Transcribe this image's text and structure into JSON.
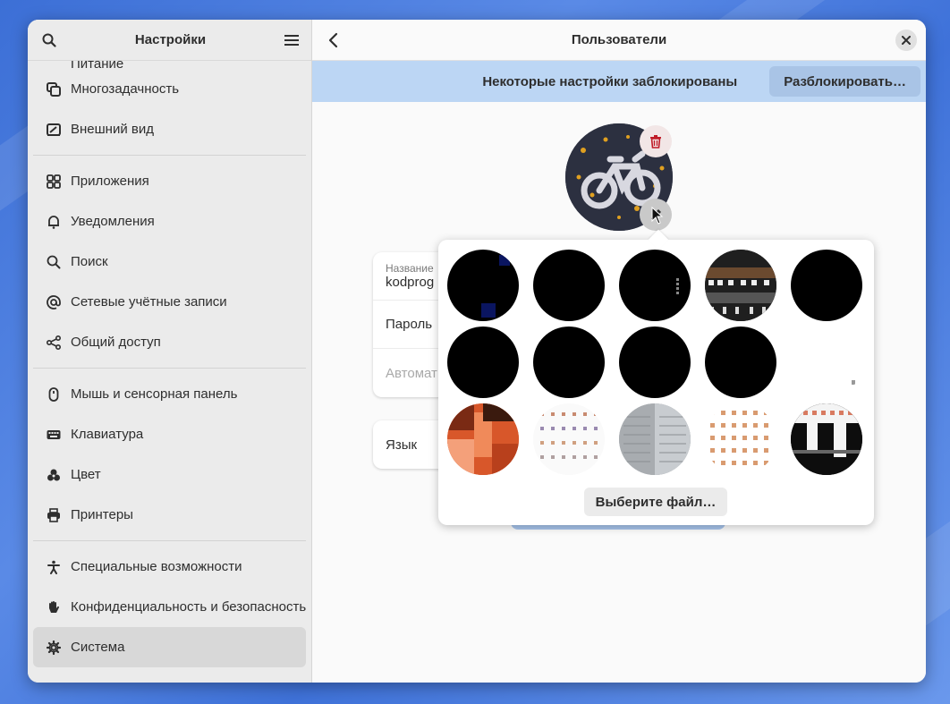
{
  "sidebar": {
    "title": "Настройки",
    "items_top_cut": "Питание",
    "groups": [
      [
        {
          "label": "Многозадачность",
          "icon": "multitasking-icon"
        },
        {
          "label": "Внешний вид",
          "icon": "appearance-icon"
        }
      ],
      [
        {
          "label": "Приложения",
          "icon": "apps-grid-icon"
        },
        {
          "label": "Уведомления",
          "icon": "bell-icon"
        },
        {
          "label": "Поиск",
          "icon": "search-icon"
        },
        {
          "label": "Сетевые учётные записи",
          "icon": "at-sign-icon"
        },
        {
          "label": "Общий доступ",
          "icon": "share-icon"
        }
      ],
      [
        {
          "label": "Мышь и сенсорная панель",
          "icon": "mouse-icon"
        },
        {
          "label": "Клавиатура",
          "icon": "keyboard-icon"
        },
        {
          "label": "Цвет",
          "icon": "color-icon"
        },
        {
          "label": "Принтеры",
          "icon": "printer-icon"
        }
      ],
      [
        {
          "label": "Специальные возможности",
          "icon": "accessibility-icon"
        },
        {
          "label": "Конфиденциальность и безопасность",
          "icon": "hand-icon"
        },
        {
          "label": "Система",
          "icon": "gear-icon",
          "active": true
        }
      ]
    ]
  },
  "main": {
    "title": "Пользователи",
    "banner": {
      "text": "Некоторые настройки заблокированы",
      "unlock_label": "Разблокировать…"
    },
    "account": {
      "name_label": "Название",
      "name_value": "kodprog",
      "password_label": "Пароль",
      "autologin_label": "Автомат",
      "language_label": "Язык"
    },
    "popover": {
      "choose_file_label": "Выберите файл…"
    }
  },
  "colors": {
    "banner_bg": "#bcd6f4",
    "accent": "#3584e4",
    "trash": "#c01c28"
  }
}
